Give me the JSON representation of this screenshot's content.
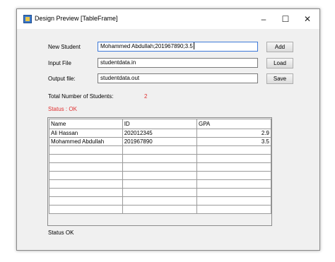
{
  "window": {
    "title": "Design Preview [TableFrame]",
    "controls": {
      "minimize": "–",
      "maximize": "☐",
      "close": "✕"
    }
  },
  "form": {
    "new_student_label": "New Student",
    "new_student_value": "Mohammed Abdullah;201967890;3.5",
    "add_label": "Add",
    "input_file_label": "Input File",
    "input_file_value": "studentdata.in",
    "load_label": "Load",
    "output_file_label": "Output file:",
    "output_file_value": "studentdata.out",
    "save_label": "Save"
  },
  "summary": {
    "total_label": "Total Number of Students:",
    "total_value": "2",
    "status_top": "Status : OK"
  },
  "table": {
    "columns": [
      "Name",
      "ID",
      "GPA"
    ],
    "rows": [
      [
        "Ali Hassan",
        "202012345",
        "2.9"
      ],
      [
        "Mohammed Abdullah",
        "201967890",
        "3.5"
      ],
      [
        "",
        "",
        ""
      ],
      [
        "",
        "",
        ""
      ],
      [
        "",
        "",
        ""
      ],
      [
        "",
        "",
        ""
      ],
      [
        "",
        "",
        ""
      ],
      [
        "",
        "",
        ""
      ],
      [
        "",
        "",
        ""
      ],
      [
        "",
        "",
        ""
      ]
    ]
  },
  "footer": {
    "status_bottom": "Status OK"
  },
  "colors": {
    "status_red": "#e03030",
    "focus_border": "#3c78d8"
  }
}
